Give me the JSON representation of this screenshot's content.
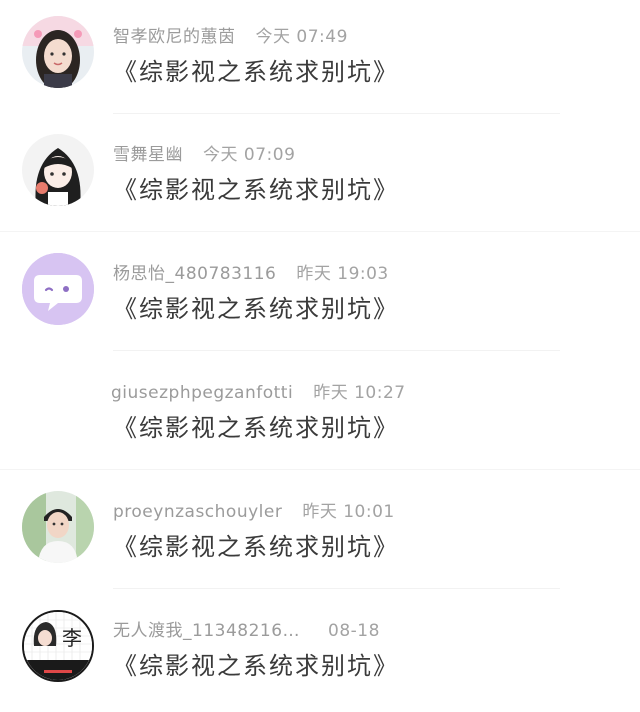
{
  "comments": [
    {
      "username": "智孝欧尼的蕙茵",
      "time": "今天 07:49",
      "text": "《综影视之系统求别坑》",
      "avatar": "girl-photo-avatar"
    },
    {
      "username": "雪舞星幽",
      "time": "今天 07:09",
      "text": "《综影视之系统求别坑》",
      "avatar": "anime-girl-avatar"
    },
    {
      "username": "杨思怡_480783116",
      "time": "昨天 19:03",
      "text": "《综影视之系统求别坑》",
      "avatar": "chat-bubble-avatar"
    },
    {
      "username": "giusezphpegzanfotti",
      "time": "昨天 10:27",
      "text": "《综影视之系统求别坑》"
    },
    {
      "username": "proeynzaschouyler",
      "time": "昨天 10:01",
      "text": "《综影视之系统求别坑》",
      "avatar": "boy-photo-avatar"
    },
    {
      "username": "无人渡我_11348216…",
      "time": "08-18",
      "text": "《综影视之系统求别坑》",
      "avatar": "li-character-avatar"
    }
  ],
  "avatar_li_char": "李",
  "colors": {
    "chat_bubble_bg": "#d7c4f2",
    "meta_text": "#9b9b9b",
    "body_text": "#3a3a3a"
  }
}
